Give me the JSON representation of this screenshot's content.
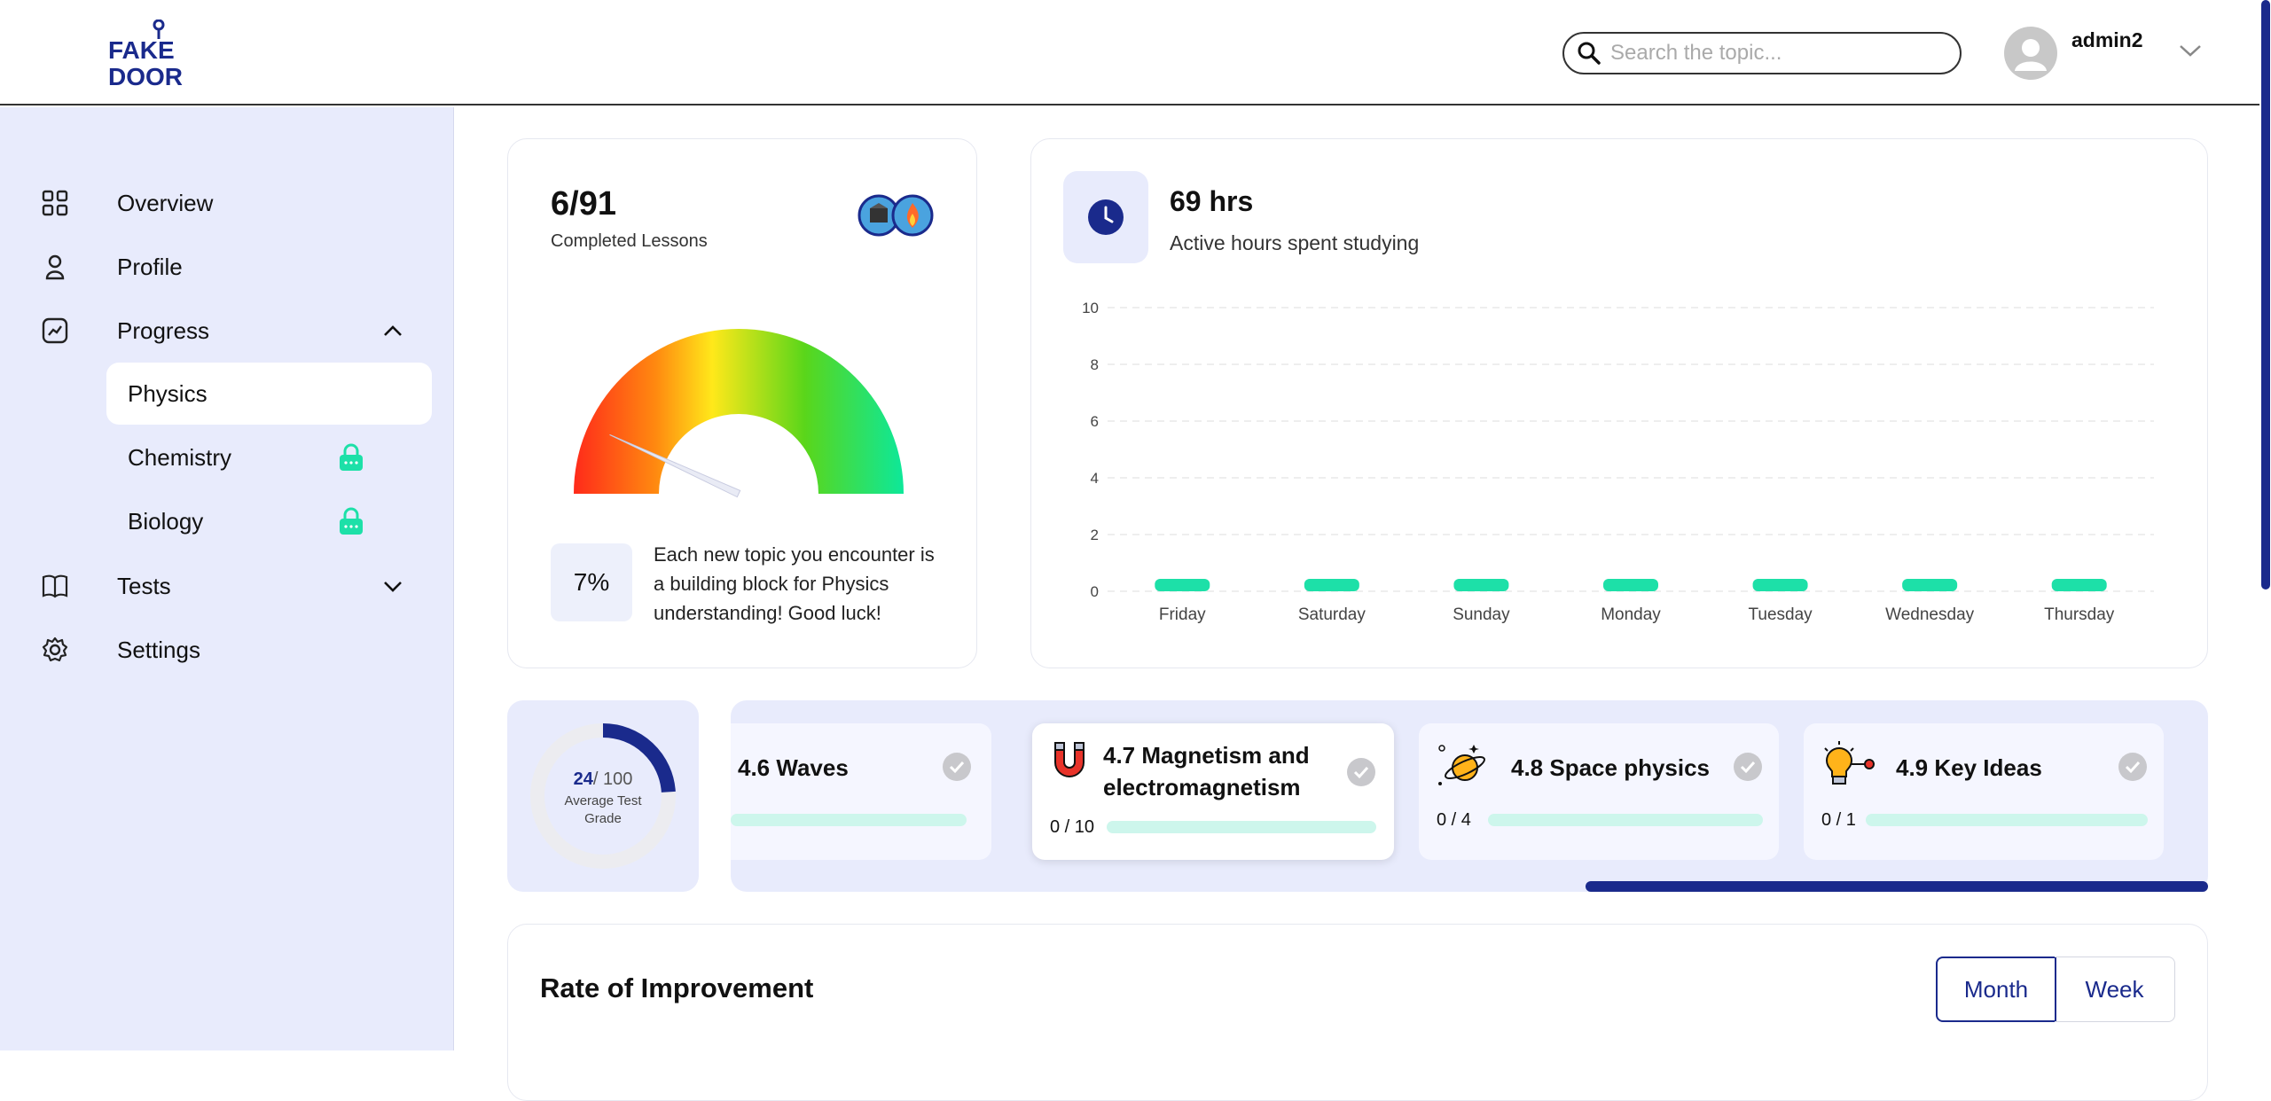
{
  "brand": {
    "logo_text_top": "FAKE",
    "logo_text_bottom": "DOOR"
  },
  "header": {
    "search_placeholder": "Search the topic...",
    "username": "admin2"
  },
  "sidebar": {
    "items": [
      {
        "label": "Overview",
        "icon": "grid-icon"
      },
      {
        "label": "Profile",
        "icon": "user-icon"
      },
      {
        "label": "Progress",
        "icon": "chart-icon",
        "expanded": true
      },
      {
        "label": "Tests",
        "icon": "book-icon",
        "expanded": false
      },
      {
        "label": "Settings",
        "icon": "gear-icon"
      }
    ],
    "progress_subitems": [
      {
        "label": "Physics",
        "active": true,
        "locked": false
      },
      {
        "label": "Chemistry",
        "active": false,
        "locked": true
      },
      {
        "label": "Biology",
        "active": false,
        "locked": true
      }
    ]
  },
  "lessons": {
    "count": "6/91",
    "label": "Completed Lessons",
    "percent_text": "7%",
    "percent_value": 0.07,
    "message": "Each new topic you encounter is a building block for Physics understanding! Good luck!"
  },
  "hours": {
    "value": "69 hrs",
    "label": "Active hours spent studying"
  },
  "chart_data": {
    "type": "bar",
    "categories": [
      "Friday",
      "Saturday",
      "Sunday",
      "Monday",
      "Tuesday",
      "Wednesday",
      "Thursday"
    ],
    "values": [
      0,
      0,
      0,
      0,
      0,
      0,
      0
    ],
    "yticks": [
      "0",
      "2",
      "4",
      "6",
      "8",
      "10"
    ],
    "ylim": [
      0,
      10
    ],
    "grid": true,
    "bar_color": "#1de0a8"
  },
  "grade": {
    "value": "24",
    "max": "/ 100",
    "label": "Average Test Grade",
    "fraction": 0.24
  },
  "topics": [
    {
      "title": "4.6 Waves",
      "count": "",
      "icon": "waves-icon"
    },
    {
      "title_line1": "4.7 Magnetism and",
      "title_line2": "electromagnetism",
      "count": "0 / 10",
      "icon": "magnet-icon"
    },
    {
      "title": "4.8 Space physics",
      "count": "0 / 4",
      "icon": "planet-icon"
    },
    {
      "title": "4.9 Key Ideas",
      "count": "0 / 1",
      "icon": "lightbulb-icon"
    }
  ],
  "improvement": {
    "title": "Rate of Improvement",
    "tabs": [
      "Month",
      "Week"
    ],
    "selected": "Month"
  },
  "colors": {
    "brand_navy": "#1a2a8c",
    "accent_green": "#1de0a8",
    "sidebar_bg": "#e8ebfc"
  }
}
